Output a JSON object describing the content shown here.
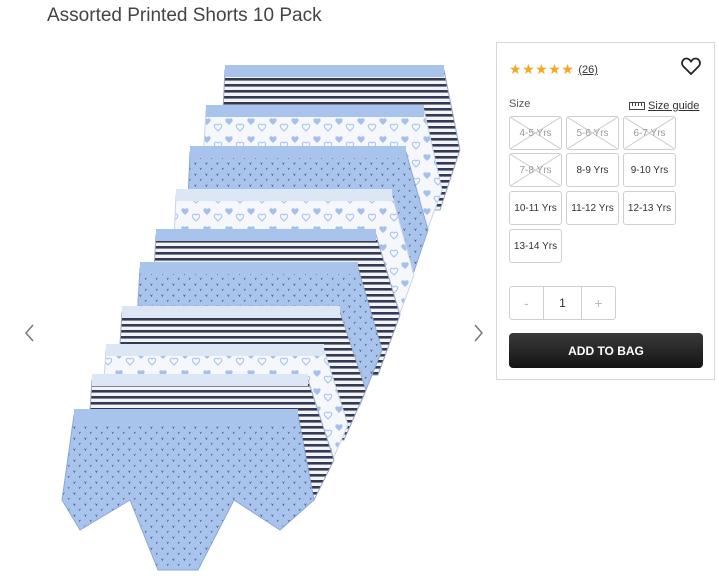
{
  "product": {
    "title": "Assorted Printed Shorts 10 Pack"
  },
  "gallery": {
    "prev_icon": "chevron-left-icon",
    "next_icon": "chevron-right-icon",
    "image_alt_colors": {
      "light_blue": "#9fbde8",
      "white": "#f5f6f8",
      "navy": "#2c3148"
    }
  },
  "panel": {
    "stars": [
      "★",
      "★",
      "★",
      "★",
      "★"
    ],
    "review_count": "(26)",
    "wishlist_icon": "heart-outline-icon",
    "size_label": "Size",
    "size_guide_icon": "ruler-icon",
    "size_guide_label": "Size guide",
    "sizes": [
      {
        "label": "4-5 Yrs",
        "available": false
      },
      {
        "label": "5-6 Yrs",
        "available": false
      },
      {
        "label": "6-7 Yrs",
        "available": false
      },
      {
        "label": "7-8 Yrs",
        "available": false
      },
      {
        "label": "8-9 Yrs",
        "available": true
      },
      {
        "label": "9-10 Yrs",
        "available": true
      },
      {
        "label": "10-11 Yrs",
        "available": true
      },
      {
        "label": "11-12 Yrs",
        "available": true
      },
      {
        "label": "12-13 Yrs",
        "available": true
      },
      {
        "label": "13-14 Yrs",
        "available": true
      }
    ],
    "quantity": {
      "minus": "-",
      "value": "1",
      "plus": "+"
    },
    "add_to_bag": "ADD TO BAG",
    "accent_star_color": "#f5a623"
  }
}
